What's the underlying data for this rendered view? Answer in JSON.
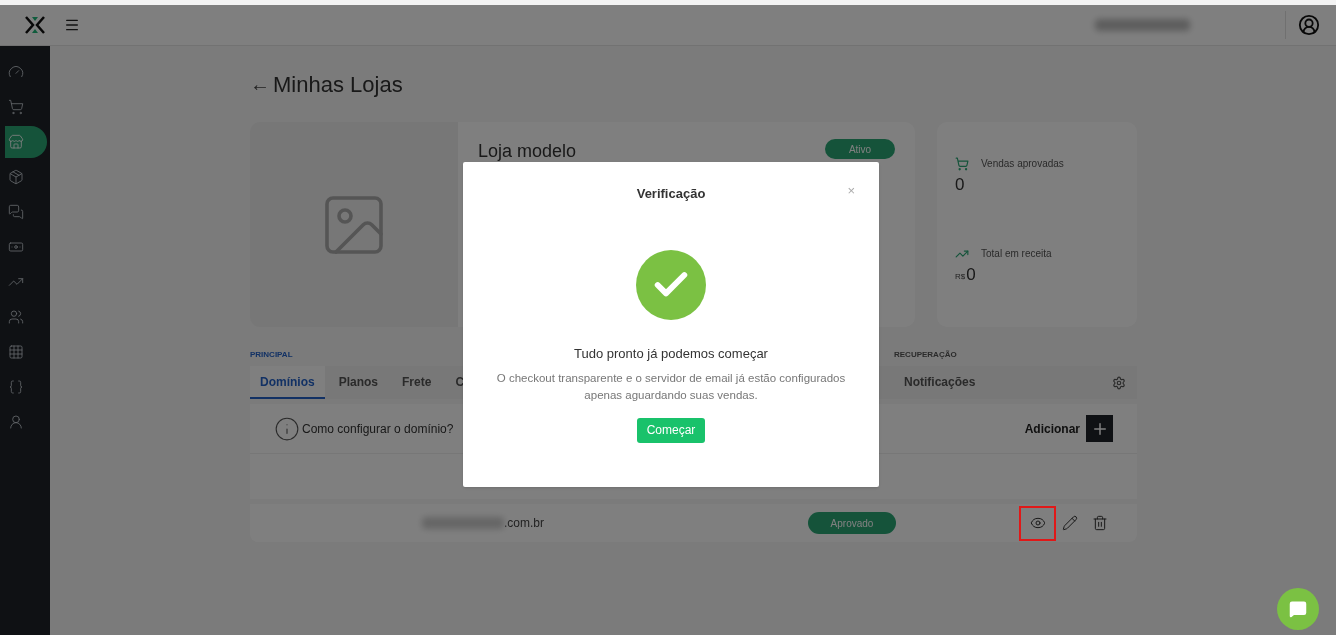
{
  "sidebar": {
    "items": [
      {
        "selected": false
      },
      {
        "selected": false
      },
      {
        "selected": true
      },
      {
        "selected": false
      },
      {
        "selected": false
      },
      {
        "selected": false
      },
      {
        "selected": false
      },
      {
        "selected": false
      },
      {
        "selected": false
      },
      {
        "selected": false
      },
      {
        "selected": false
      }
    ]
  },
  "page": {
    "back_arrow": "←",
    "title": "Minhas Lojas"
  },
  "store": {
    "name": "Loja modelo",
    "status": "Ativo"
  },
  "stats": [
    {
      "label": "Vendas aprovadas",
      "value": "0"
    },
    {
      "label": "Total em receita",
      "currency": "R$",
      "value": "0"
    }
  ],
  "sections": [
    "PRINCIPAL",
    "RECUPERAÇÃO"
  ],
  "tabs": [
    {
      "label": "Domínios",
      "selected": true
    },
    {
      "label": "Planos",
      "selected": false
    },
    {
      "label": "Frete",
      "selected": false
    },
    {
      "label": "C",
      "selected": false
    }
  ],
  "recovery_tabs": [
    {
      "label": "Notificações",
      "selected": false
    }
  ],
  "help_link": "Como configurar o domínio?",
  "add_button": "Adicionar",
  "domains": [
    {
      "domain": ".com.br",
      "status": "Aprovado"
    }
  ],
  "modal": {
    "title": "Verificação",
    "close": "×",
    "heading": "Tudo pronto já podemos começar",
    "message": "O checkout transparente e o servidor de email já estão configurados apenas aguardando suas vendas.",
    "button": "Começar"
  }
}
